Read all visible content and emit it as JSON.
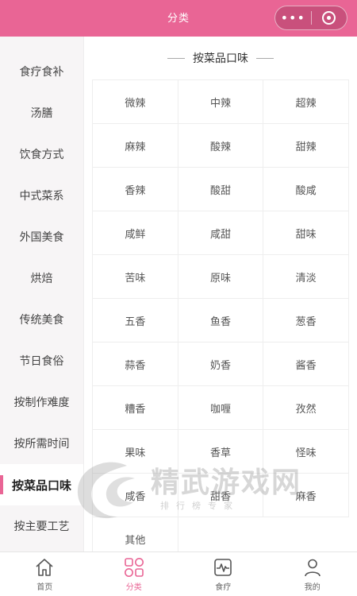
{
  "header": {
    "title": "分类"
  },
  "sidebar": {
    "items": [
      {
        "label": "食疗食补"
      },
      {
        "label": "汤膳"
      },
      {
        "label": "饮食方式"
      },
      {
        "label": "中式菜系"
      },
      {
        "label": "外国美食"
      },
      {
        "label": "烘焙"
      },
      {
        "label": "传统美食"
      },
      {
        "label": "节日食俗"
      },
      {
        "label": "按制作难度"
      },
      {
        "label": "按所需时间"
      },
      {
        "label": "按菜品口味"
      },
      {
        "label": "按主要工艺"
      }
    ]
  },
  "main": {
    "section_title": "按菜品口味",
    "cells": [
      "微辣",
      "中辣",
      "超辣",
      "麻辣",
      "酸辣",
      "甜辣",
      "香辣",
      "酸甜",
      "酸咸",
      "咸鲜",
      "咸甜",
      "甜味",
      "苦味",
      "原味",
      "清淡",
      "五香",
      "鱼香",
      "葱香",
      "蒜香",
      "奶香",
      "酱香",
      "糟香",
      "咖喱",
      "孜然",
      "果味",
      "香草",
      "怪味",
      "咸香",
      "甜香",
      "麻香",
      "其他"
    ]
  },
  "tabbar": {
    "items": [
      {
        "label": "首页",
        "icon": "home-icon"
      },
      {
        "label": "分类",
        "icon": "category-icon"
      },
      {
        "label": "食疗",
        "icon": "health-icon"
      },
      {
        "label": "我的",
        "icon": "user-icon"
      }
    ]
  },
  "watermark": {
    "title": "精武游戏网",
    "subtitle": "排行榜专家"
  },
  "colors": {
    "accent": "#e96595",
    "sidebar_bg": "#f7f5f6"
  }
}
